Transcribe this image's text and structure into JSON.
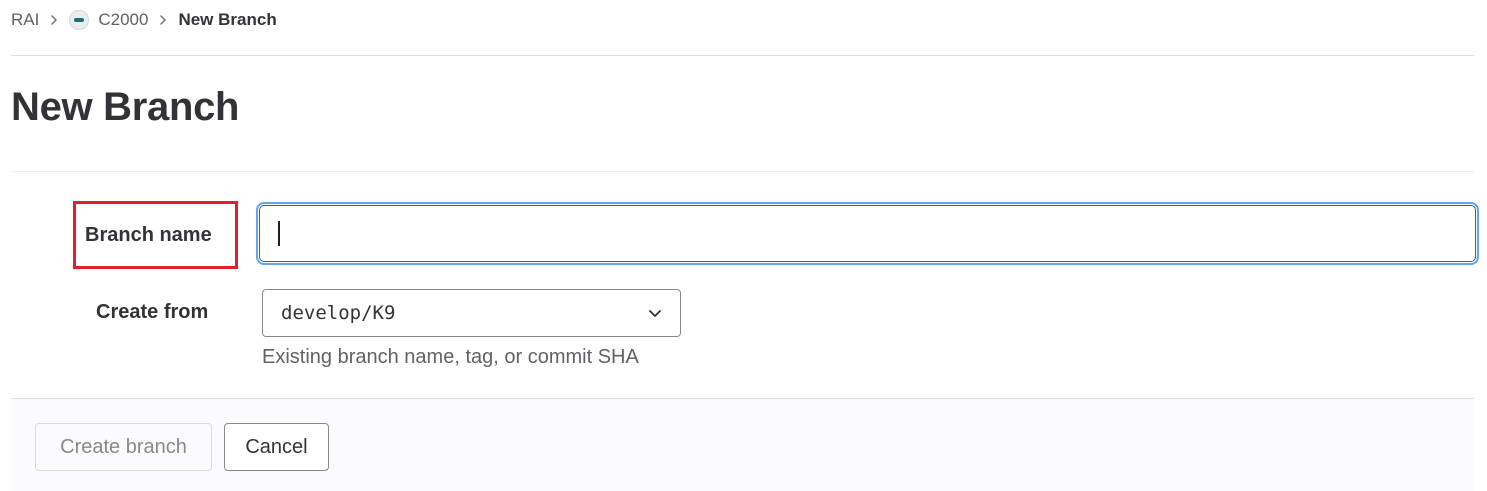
{
  "breadcrumb": {
    "group": "RAI",
    "project": "C2000",
    "current": "New Branch",
    "project_avatar_icon": "project-avatar-icon",
    "separator_icon": "chevron-right-icon"
  },
  "page_title": "New Branch",
  "form": {
    "branch_name_label": "Branch name",
    "branch_name_value": "",
    "create_from_label": "Create from",
    "create_from_value": "develop/K9",
    "create_from_help": "Existing branch name, tag, or commit SHA",
    "dropdown_icon": "chevron-down-icon"
  },
  "footer": {
    "create_button_label": "Create branch",
    "cancel_button_label": "Cancel"
  },
  "colors": {
    "annotation_outline": "#e0202a",
    "focus_ring": "#63a6e9",
    "focus_border": "#1068bf",
    "footer_background": "#fbfafd"
  }
}
